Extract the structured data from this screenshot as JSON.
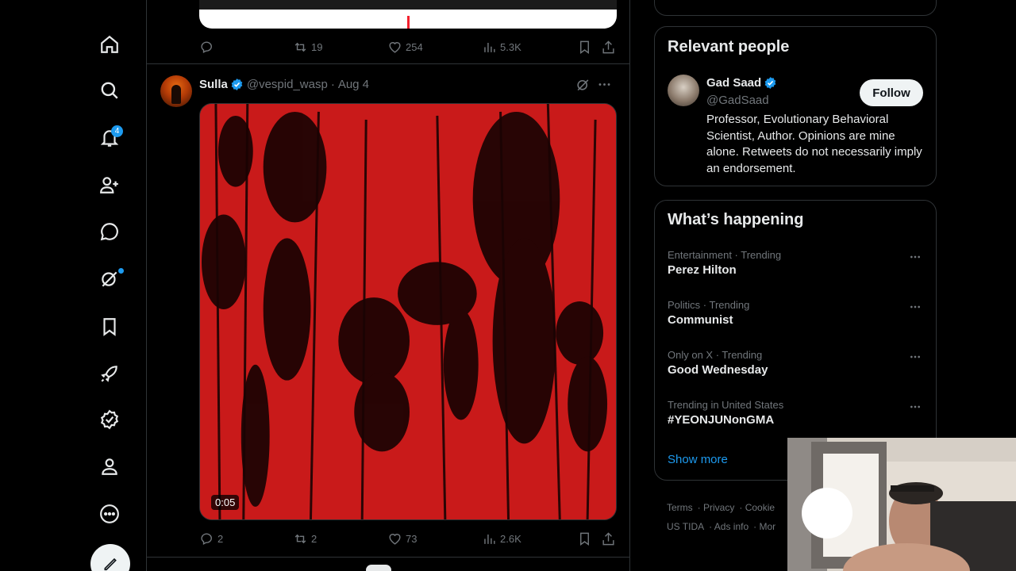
{
  "nav": {
    "notification_count": "4"
  },
  "previous_post": {
    "stats": {
      "retweets": "19",
      "likes": "254",
      "views": "5.3K"
    }
  },
  "post": {
    "name": "Sulla",
    "handle": "@vespid_wasp",
    "separator": "·",
    "date": "Aug 4",
    "video_duration": "0:05",
    "stats": {
      "replies": "2",
      "retweets": "2",
      "likes": "73",
      "views": "2.6K"
    }
  },
  "relevant_people": {
    "title": "Relevant people",
    "person": {
      "name": "Gad Saad",
      "handle": "@GadSaad",
      "follow_label": "Follow",
      "bio": "Professor, Evolutionary Behavioral Scientist, Author. Opinions are mine alone. Retweets do not necessarily imply an endorsement."
    }
  },
  "whats_happening": {
    "title": "What’s happening",
    "trends": [
      {
        "context": "Entertainment · Trending",
        "name": "Perez Hilton"
      },
      {
        "context": "Politics · Trending",
        "name": "Communist"
      },
      {
        "context": "Only on X · Trending",
        "name": "Good Wednesday"
      },
      {
        "context": "Trending in United States",
        "name": "#YEONJUNonGMA"
      }
    ],
    "show_more": "Show more"
  },
  "footer": {
    "links": [
      "Terms",
      "Privacy",
      "Cookie",
      "US TIDA",
      "Ads info",
      "Mor"
    ]
  },
  "colors": {
    "accent": "#1d9bf0",
    "background": "#000000",
    "border": "#2f3336",
    "secondary_text": "#71767b",
    "video_red": "#c81818"
  }
}
